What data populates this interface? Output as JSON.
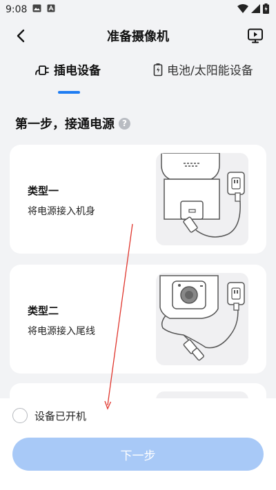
{
  "status_bar": {
    "time": "9:08"
  },
  "header": {
    "title": "准备摄像机"
  },
  "tabs": [
    {
      "label": "插电设备",
      "active": true
    },
    {
      "label": "电池/太阳能设备",
      "active": false
    }
  ],
  "step": {
    "title": "第一步，接通电源",
    "help_glyph": "?"
  },
  "cards": [
    {
      "type": "类型一",
      "desc": "将电源接入机身"
    },
    {
      "type": "类型二",
      "desc": "将电源接入尾线"
    }
  ],
  "bottom": {
    "checkbox_label": "设备已开机",
    "checkbox_checked": false,
    "next_label": "下一步"
  },
  "colors": {
    "accent": "#1e7cf2",
    "button_disabled": "#a8c9f7",
    "annotation_arrow": "#e0342b"
  }
}
